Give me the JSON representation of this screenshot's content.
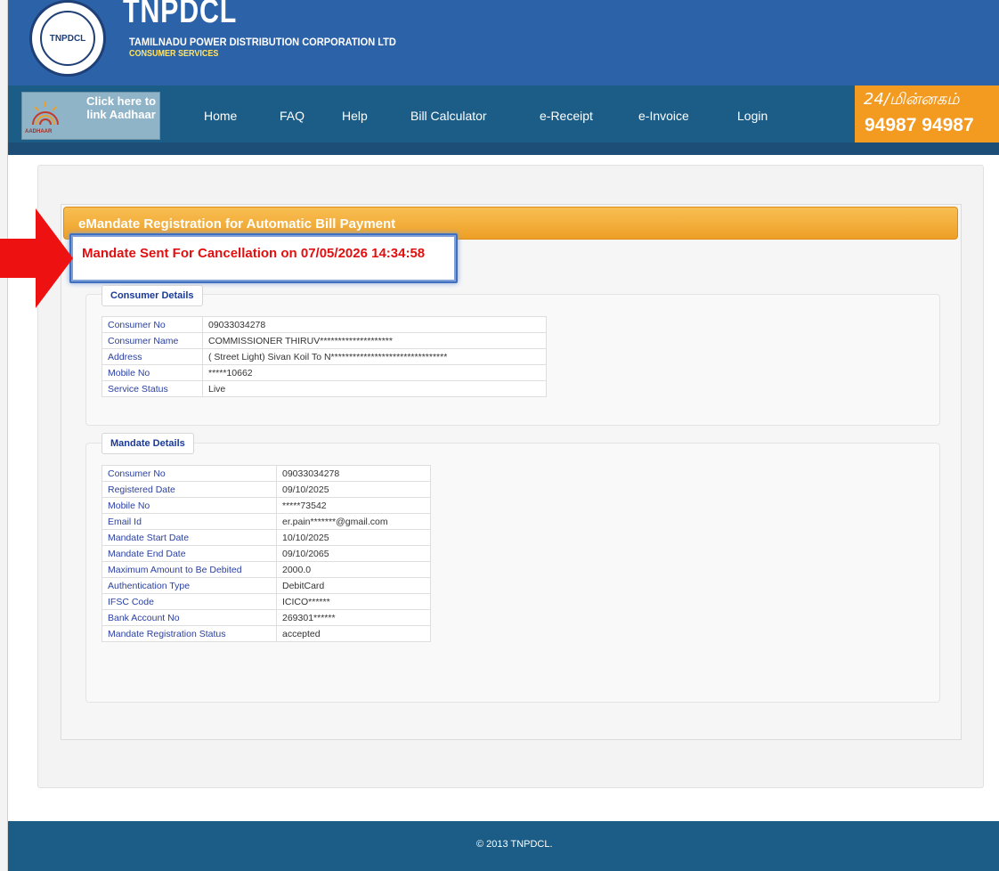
{
  "header": {
    "logo_text": "TNPDCL",
    "brand_title": "TNPDCL",
    "brand_subtitle": "TAMILNADU POWER DISTRIBUTION CORPORATION LTD",
    "brand_tagline": "CONSUMER SERVICES"
  },
  "nav": {
    "aadhaar_link": "Click here to link Aadhaar",
    "aadhaar_logo_word": "AADHAAR",
    "items": [
      "Home",
      "FAQ",
      "Help",
      "Bill Calculator",
      "e-Receipt",
      "e-Invoice",
      "Login"
    ],
    "helpline_label": "24/மின்னகம்",
    "helpline_number": "94987 94987"
  },
  "section": {
    "title": "eMandate Registration for Automatic Bill Payment",
    "notice": "Mandate Sent For Cancellation on 07/05/2026 14:34:58"
  },
  "consumer_details": {
    "legend": "Consumer Details",
    "rows": [
      {
        "label": "Consumer No",
        "value": "09033034278"
      },
      {
        "label": "Consumer Name",
        "value": "COMMISSIONER THIRUV********************"
      },
      {
        "label": "Address",
        "value": "( Street Light) Sivan Koil To N********************************"
      },
      {
        "label": "Mobile No",
        "value": "*****10662"
      },
      {
        "label": "Service Status",
        "value": "Live"
      }
    ]
  },
  "mandate_details": {
    "legend": "Mandate Details",
    "rows": [
      {
        "label": "Consumer No",
        "value": "09033034278"
      },
      {
        "label": "Registered Date",
        "value": "09/10/2025"
      },
      {
        "label": "Mobile No",
        "value": "*****73542"
      },
      {
        "label": "Email Id",
        "value": "er.pain*******@gmail.com"
      },
      {
        "label": "Mandate Start Date",
        "value": "10/10/2025"
      },
      {
        "label": "Mandate End Date",
        "value": "09/10/2065"
      },
      {
        "label": "Maximum Amount to Be Debited",
        "value": "2000.0"
      },
      {
        "label": "Authentication Type",
        "value": "DebitCard"
      },
      {
        "label": "IFSC Code",
        "value": "ICICO******"
      },
      {
        "label": "Bank Account No",
        "value": "269301******"
      },
      {
        "label": "Mandate Registration Status",
        "value": "accepted"
      }
    ]
  },
  "footer": {
    "copyright": "© 2013 TNPDCL."
  },
  "colors": {
    "header_blue": "#2b62a8",
    "nav_blue": "#1b5d87",
    "section_orange": "#f39a21",
    "notice_red": "#e01010",
    "label_blue": "#2a3fa0"
  }
}
